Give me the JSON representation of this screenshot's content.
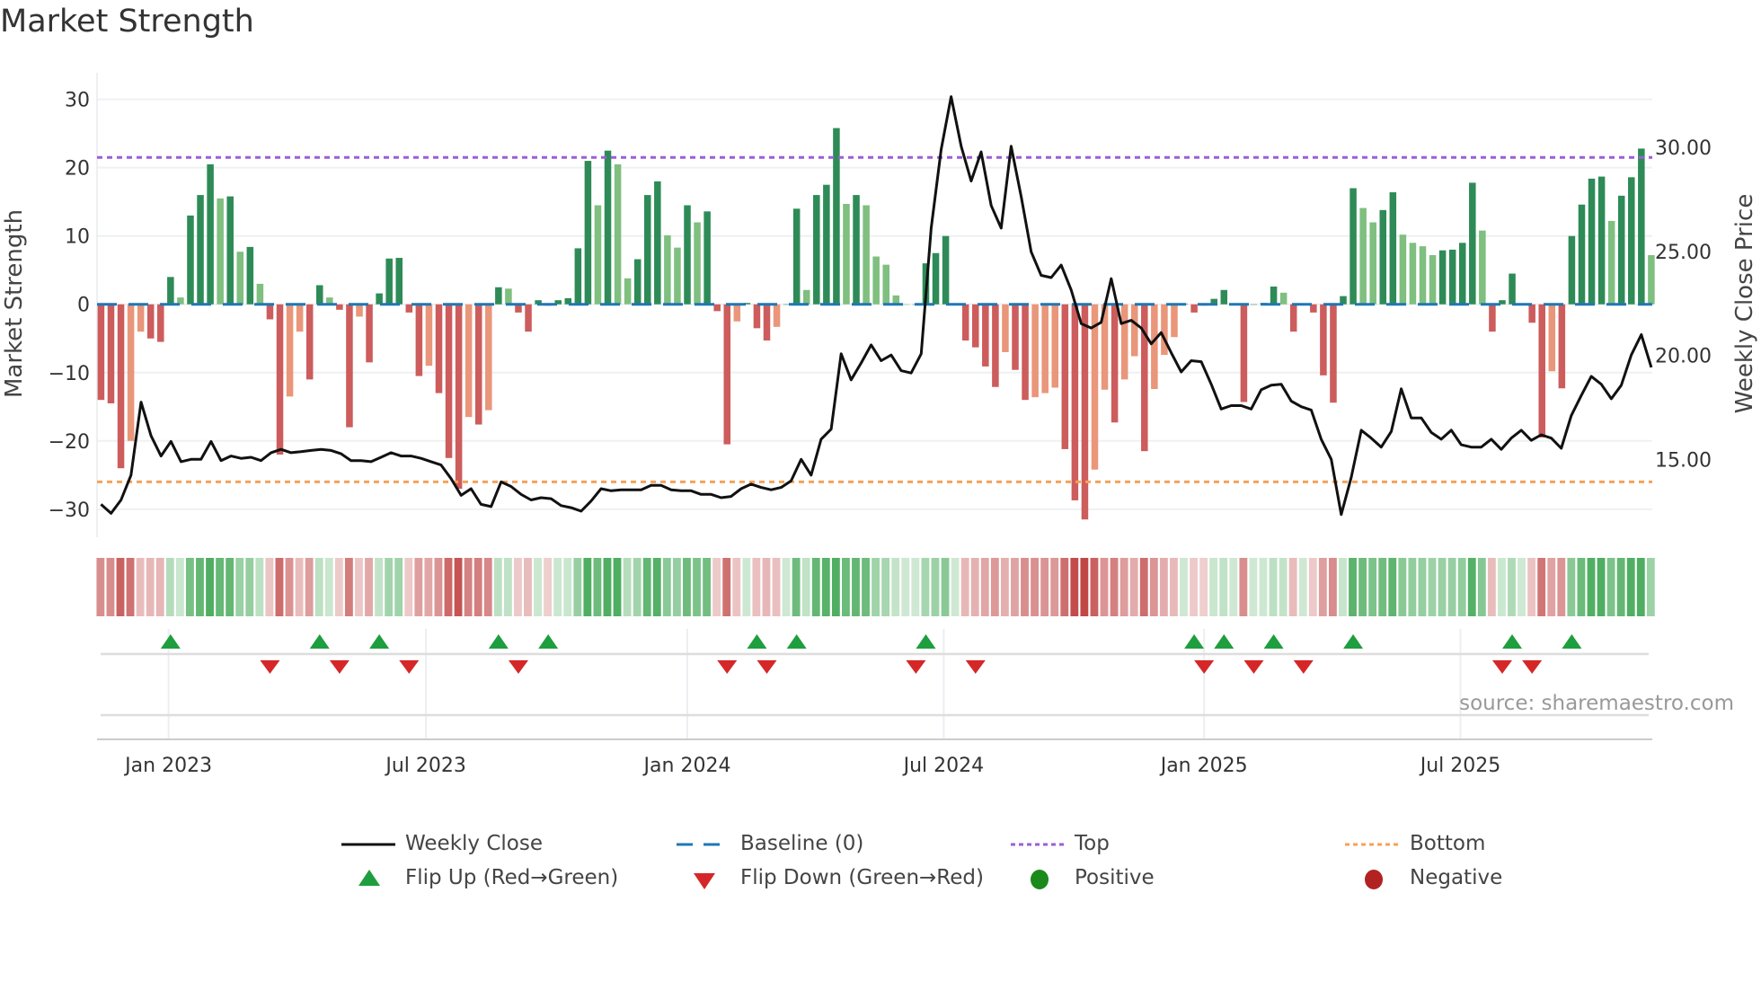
{
  "title": "Market Strength",
  "source": "source: sharemaestro.com",
  "colors": {
    "pos_strong": "#2e8b57",
    "pos_weak": "#7fbf7f",
    "neg_strong": "#cd5c5c",
    "neg_weak": "#e9967a",
    "close": "#111111",
    "baseline": "#1f77b4",
    "top": "#9b5fd6",
    "bottom": "#f4a25a",
    "flip_up": "#1e9e3e",
    "flip_down": "#d62728",
    "positive": "#1a8a1a",
    "negative": "#b22222"
  },
  "legend": [
    {
      "label": "Weekly Close",
      "symbol": "solid-line"
    },
    {
      "label": "Baseline (0)",
      "symbol": "dashed-line"
    },
    {
      "label": "Top",
      "symbol": "dotted-line-purple"
    },
    {
      "label": "Bottom",
      "symbol": "dotted-line-orange"
    },
    {
      "label": "Flip Up (Red→Green)",
      "symbol": "triangle-up"
    },
    {
      "label": "Flip Down (Green→Red)",
      "symbol": "triangle-down"
    },
    {
      "label": "Positive",
      "symbol": "circle-green"
    },
    {
      "label": "Negative",
      "symbol": "circle-red"
    }
  ],
  "chart_data": {
    "type": "bar",
    "title": "Market Strength",
    "ylabel": "Market Strength",
    "y2label": "Weekly Close Price",
    "start_week": "2022-11-14",
    "x_interval": "weekly",
    "xlim_weeks": [
      -0.4,
      156.1
    ],
    "ylim": [
      -34.1,
      33.9
    ],
    "y2lim": [
      11.27,
      33.58
    ],
    "yticks": [
      {
        "v": 30,
        "label": "30"
      },
      {
        "v": 20,
        "label": "20"
      },
      {
        "v": 10,
        "label": "10"
      },
      {
        "v": 0,
        "label": "0"
      },
      {
        "v": -10,
        "label": "−10"
      },
      {
        "v": -20,
        "label": "−20"
      },
      {
        "v": -30,
        "label": "−30"
      }
    ],
    "y2ticks": [
      {
        "v": 30,
        "label": "30.00"
      },
      {
        "v": 25,
        "label": "25.00"
      },
      {
        "v": 20,
        "label": "20.00"
      },
      {
        "v": 15,
        "label": "15.00"
      }
    ],
    "xticks": [
      {
        "week": 6.8,
        "label": "Jan 2023"
      },
      {
        "week": 32.7,
        "label": "Jul 2023"
      },
      {
        "week": 59.0,
        "label": "Jan 2024"
      },
      {
        "week": 84.8,
        "label": "Jul 2024"
      },
      {
        "week": 111.0,
        "label": "Jan 2025"
      },
      {
        "week": 136.8,
        "label": "Jul 2025"
      }
    ],
    "top_level": 21.5,
    "bottom_level": -26,
    "baseline": 0,
    "strength": [
      -14,
      -14.5,
      -24,
      -20,
      -4,
      -5,
      -5.5,
      4,
      1,
      13,
      16,
      20.5,
      15.5,
      15.8,
      7.7,
      8.4,
      3,
      -2.2,
      -22,
      -13.5,
      -4,
      -11,
      2.8,
      1,
      -0.8,
      -18,
      -1.8,
      -8.5,
      1.6,
      6.7,
      6.8,
      -1.2,
      -10.5,
      -9,
      -13,
      -22.5,
      -27,
      -16.5,
      -17.6,
      -15.5,
      2.5,
      2.3,
      -1.2,
      -4,
      0.6,
      -0.2,
      0.6,
      0.9,
      8.2,
      21,
      14.5,
      22.5,
      20.5,
      3.8,
      6.6,
      16,
      18,
      10.1,
      8.3,
      14.5,
      12,
      13.6,
      -1,
      -20.5,
      -2.5,
      0.2,
      -3.5,
      -5.3,
      -3.3,
      0,
      14,
      2.1,
      16,
      17.5,
      25.8,
      14.7,
      16,
      14.5,
      7,
      5.8,
      1.3,
      0,
      0,
      6,
      7.5,
      10,
      0.1,
      -5.3,
      -6.3,
      -9.1,
      -12.1,
      -7,
      -9.6,
      -14,
      -13.6,
      -13,
      -12.2,
      -21.2,
      -28.7,
      -31.5,
      -24.2,
      -12.5,
      -17.3,
      -11,
      -7.6,
      -21.5,
      -12.4,
      -7.4,
      -4.8,
      0.1,
      -1.2,
      -0.2,
      0.8,
      2.1,
      0.1,
      -14.3,
      0,
      0.2,
      2.6,
      1.7,
      -4,
      0,
      -1.2,
      -10.4,
      -14.4,
      1.2,
      17,
      14.1,
      12,
      13.8,
      16.4,
      10.2,
      9,
      8.5,
      7.2,
      7.9,
      8,
      9,
      17.8,
      10.8,
      -4,
      0.6,
      4.5,
      0,
      -2.7,
      -19.5,
      -9.8,
      -12.3,
      10,
      14.6,
      18.4,
      18.7,
      12.2,
      15.9,
      18.6,
      22.8,
      7.2
    ],
    "weekly_close": [
      12.85,
      12.42,
      13.06,
      14.25,
      17.76,
      16.14,
      15.17,
      15.87,
      14.9,
      15.01,
      15.01,
      15.87,
      14.95,
      15.17,
      15.06,
      15.11,
      14.95,
      15.33,
      15.49,
      15.33,
      15.38,
      15.44,
      15.49,
      15.44,
      15.28,
      14.95,
      14.95,
      14.9,
      15.11,
      15.33,
      15.17,
      15.17,
      15.06,
      14.9,
      14.74,
      14.09,
      13.28,
      13.6,
      12.85,
      12.74,
      13.93,
      13.71,
      13.33,
      13.06,
      13.17,
      13.12,
      12.79,
      12.69,
      12.52,
      13.01,
      13.6,
      13.5,
      13.55,
      13.55,
      13.55,
      13.76,
      13.76,
      13.55,
      13.5,
      13.5,
      13.33,
      13.33,
      13.17,
      13.23,
      13.6,
      13.82,
      13.66,
      13.55,
      13.66,
      13.98,
      15.01,
      14.25,
      15.98,
      16.46,
      20.08,
      18.83,
      19.64,
      20.51,
      19.75,
      20.02,
      19.27,
      19.16,
      20.08,
      26.12,
      29.89,
      32.43,
      30.05,
      28.38,
      29.78,
      27.2,
      26.12,
      30.05,
      27.63,
      24.98,
      23.85,
      23.74,
      24.34,
      23.15,
      21.53,
      21.32,
      21.59,
      23.69,
      21.53,
      21.69,
      21.32,
      20.56,
      21.1,
      20.13,
      19.21,
      19.75,
      19.7,
      18.62,
      17.43,
      17.59,
      17.59,
      17.43,
      18.35,
      18.57,
      18.62,
      17.81,
      17.54,
      17.38,
      15.98,
      15.01,
      12.36,
      14.14,
      16.41,
      16.03,
      15.6,
      16.35,
      18.4,
      17.0,
      17.0,
      16.3,
      15.98,
      16.41,
      15.71,
      15.6,
      15.6,
      15.98,
      15.49,
      16.03,
      16.41,
      15.92,
      16.19,
      16.03,
      15.54,
      17.11,
      18.08,
      19.0,
      18.62,
      17.92,
      18.57,
      20.02,
      21.0,
      19.43
    ],
    "flip_up_weeks": [
      "2023-01-02",
      "2023-04-17",
      "2023-05-29",
      "2023-08-21",
      "2023-09-25",
      "2024-02-19",
      "2024-03-18",
      "2024-06-17",
      "2024-12-23",
      "2025-01-13",
      "2025-02-17",
      "2025-04-14",
      "2025-08-04",
      "2025-09-15"
    ],
    "flip_down_weeks": [
      "2023-03-13",
      "2023-05-01",
      "2023-06-19",
      "2023-09-04",
      "2024-01-29",
      "2024-02-26",
      "2024-06-10",
      "2024-07-22",
      "2024-12-30",
      "2025-02-03",
      "2025-03-10",
      "2025-07-28",
      "2025-08-18"
    ]
  }
}
